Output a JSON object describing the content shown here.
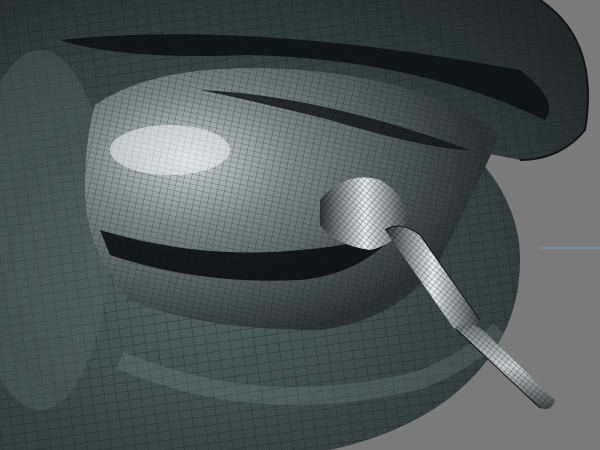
{
  "viewport": {
    "background_color": "#7a7a7a",
    "mesh_base_color": "#3a4444",
    "mesh_highlight_color": "#e8eded",
    "wireframe_line_color": "#1a1f1f",
    "axis_line_color": "#5fa8d8"
  },
  "scene": {
    "object": "wireframe-mesh-model",
    "parts": [
      "outer-shell",
      "inner-cavity",
      "nozzle-stem"
    ]
  }
}
